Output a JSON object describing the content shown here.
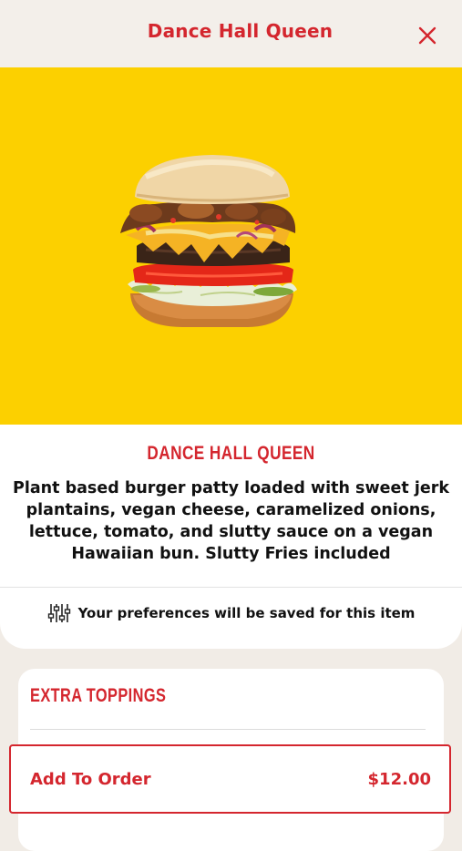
{
  "header": {
    "title": "Dance Hall Queen",
    "close_icon": "close-icon"
  },
  "hero": {
    "background_color": "#fcd000",
    "image": "burger-photo"
  },
  "item": {
    "title": "DANCE HALL QUEEN",
    "description": "Plant based burger patty loaded with sweet jerk plantains, vegan cheese, caramelized onions, lettuce, tomato, and slutty sauce on a vegan Hawaiian bun. Slutty Fries included"
  },
  "preferences": {
    "icon": "sliders-icon",
    "text": "Your preferences will be saved for this item"
  },
  "toppings": {
    "title": "EXTRA TOPPINGS"
  },
  "order": {
    "label": "Add To Order",
    "price": "$12.00"
  },
  "colors": {
    "accent": "#d4262e",
    "page_bg": "#f1ece6"
  }
}
